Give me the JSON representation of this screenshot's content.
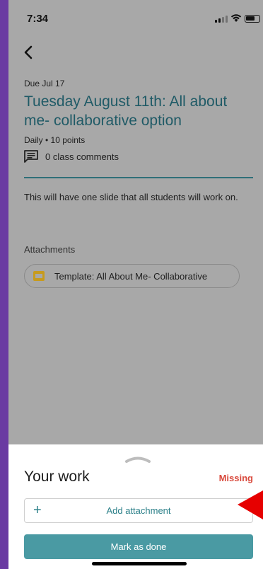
{
  "status_bar": {
    "time": "7:34"
  },
  "assignment": {
    "due": "Due Jul 17",
    "title": "Tuesday August 11th: All about me- collaborative option",
    "meta": "Daily • 10 points",
    "comments_label": "0 class comments",
    "description": "This will have one slide that all students will work on."
  },
  "attachments": {
    "heading": "Attachments",
    "items": [
      {
        "label": "Template: All About Me- Collaborative",
        "icon": "slides-icon"
      }
    ]
  },
  "your_work": {
    "title": "Your work",
    "status": "Missing",
    "add_attachment_label": "Add attachment",
    "add_icon": "+",
    "mark_done_label": "Mark as done"
  },
  "colors": {
    "accent": "#4a9aa3",
    "title_teal": "#1f5a66",
    "missing_red": "#d94a3d",
    "arrow_red": "#e60000",
    "frame_purple": "#6a3aa2"
  }
}
